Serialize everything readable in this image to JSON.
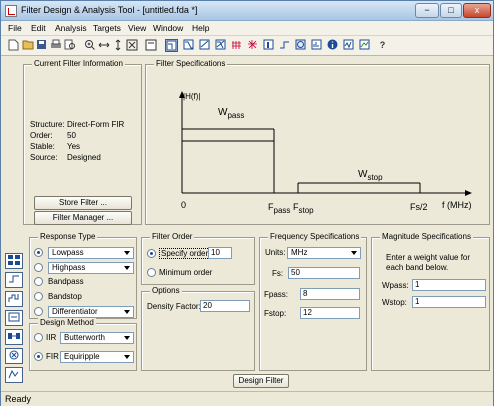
{
  "window": {
    "title": "Filter Design & Analysis Tool - [untitled.fda *]",
    "min": "−",
    "max": "□",
    "close": "x"
  },
  "menu": [
    "File",
    "Edit",
    "Analysis",
    "Targets",
    "View",
    "Window",
    "Help"
  ],
  "toolbar": {
    "help_glyph": "?"
  },
  "current_filter": {
    "title": "Current Filter Information",
    "rows": [
      {
        "label": "Structure:",
        "value": "Direct-Form FIR"
      },
      {
        "label": "Order:",
        "value": "50"
      },
      {
        "label": "Stable:",
        "value": "Yes"
      },
      {
        "label": "Source:",
        "value": "Designed"
      }
    ],
    "store_button": "Store Filter ...",
    "manager_button": "Filter Manager ..."
  },
  "filter_specs": {
    "title": "Filter Specifications",
    "y_axis": "|H(f)|",
    "wpass": "W",
    "wpass_sub": "pass",
    "wstop": "W",
    "wstop_sub": "stop",
    "zero": "0",
    "fpass": "F",
    "fpass_sub": "pass",
    "fstop": "F",
    "fstop_sub": "stop",
    "fs2": "Fs/2",
    "xlabel": "f (MHz)"
  },
  "response_type": {
    "title": "Response Type",
    "options": [
      {
        "label": "",
        "value": "Lowpass",
        "selected": true
      },
      {
        "label": "",
        "value": "Highpass",
        "selected": false
      },
      {
        "label": "Bandpass",
        "value": "",
        "selected": false
      },
      {
        "label": "Bandstop",
        "value": "",
        "selected": false
      },
      {
        "label": "",
        "value": "Differentiator",
        "selected": false
      }
    ]
  },
  "design_method": {
    "title": "Design Method",
    "iir_label": "IIR",
    "iir_value": "Butterworth",
    "fir_label": "FIR",
    "fir_value": "Equiripple",
    "selected": "FIR"
  },
  "filter_order": {
    "title": "Filter Order",
    "specify_label": "Specify order:",
    "specify_value": "10",
    "minimum_label": "Minimum order",
    "selected": "specify"
  },
  "options": {
    "title": "Options",
    "density_label": "Density Factor:",
    "density_value": "20"
  },
  "freq_specs": {
    "title": "Frequency Specifications",
    "units_label": "Units:",
    "units_value": "MHz",
    "fs_label": "Fs:",
    "fs_value": "50",
    "fpass_label": "Fpass:",
    "fpass_value": "8",
    "fstop_label": "Fstop:",
    "fstop_value": "12"
  },
  "mag_specs": {
    "title": "Magnitude Specifications",
    "note": "Enter a weight value for each band below.",
    "wpass_label": "Wpass:",
    "wpass_value": "1",
    "wstop_label": "Wstop:",
    "wstop_value": "1"
  },
  "design_button": "Design Filter",
  "status": "Ready",
  "colors": {
    "accent": "#1c4b95",
    "panel": "#ece9d8"
  }
}
